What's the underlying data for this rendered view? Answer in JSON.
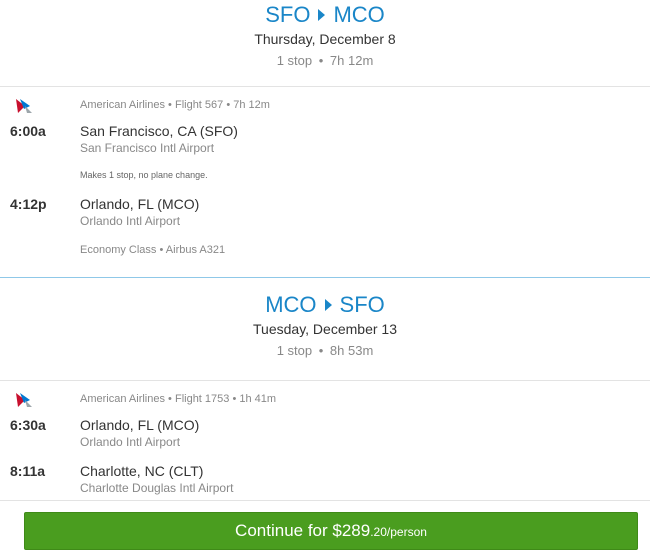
{
  "outbound": {
    "from": "SFO",
    "to": "MCO",
    "date": "Thursday, December 8",
    "stops": "1 stop",
    "duration": "7h 12m",
    "segment": {
      "airline": "American Airlines",
      "flight": "Flight 567",
      "segment_duration": "7h 12m",
      "depart_time": "6:00a",
      "depart_city": "San Francisco, CA (SFO)",
      "depart_airport": "San Francisco Intl Airport",
      "stop_note": "Makes 1 stop, no plane change.",
      "arrive_time": "4:12p",
      "arrive_city": "Orlando, FL (MCO)",
      "arrive_airport": "Orlando Intl Airport",
      "cabin": "Economy Class",
      "aircraft": "Airbus A321"
    }
  },
  "return": {
    "from": "MCO",
    "to": "SFO",
    "date": "Tuesday, December 13",
    "stops": "1 stop",
    "duration": "8h 53m",
    "segment": {
      "airline": "American Airlines",
      "flight": "Flight 1753",
      "segment_duration": "1h 41m",
      "depart_time": "6:30a",
      "depart_city": "Orlando, FL (MCO)",
      "depart_airport": "Orlando Intl Airport",
      "arrive_time": "8:11a",
      "arrive_city": "Charlotte, NC (CLT)",
      "arrive_airport": "Charlotte Douglas Intl Airport"
    }
  },
  "cta": {
    "prefix": "Continue for ",
    "price_main": "$289",
    "price_cents": ".20/person"
  },
  "sep": "•",
  "icons": {
    "airline_logo": "american-airlines-logo-icon",
    "route_arrow": "route-arrow-icon"
  },
  "colors": {
    "accent": "#1a86c8",
    "cta": "#4a9d1f"
  }
}
